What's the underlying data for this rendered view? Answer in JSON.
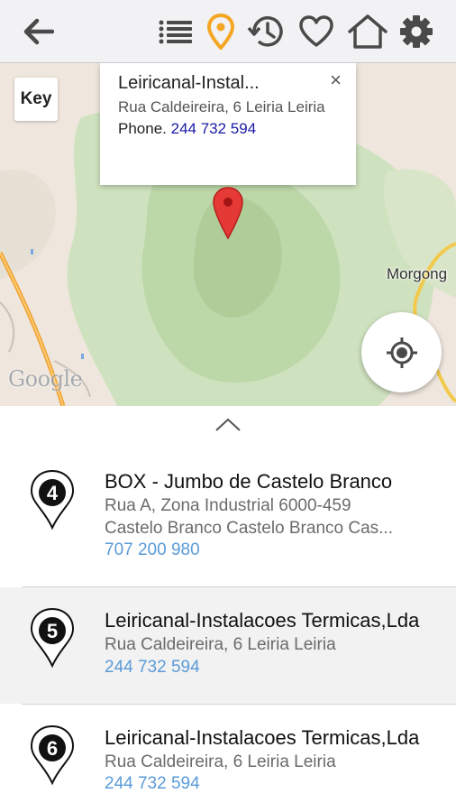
{
  "toolbar": {
    "icons": [
      "back-arrow-icon",
      "list-icon",
      "map-pin-icon",
      "history-icon",
      "heart-icon",
      "home-icon",
      "gear-icon"
    ],
    "accent": "#f5a623",
    "icon_color": "#4a4a4a"
  },
  "map": {
    "key_label": "Key",
    "place_label": "Morgong",
    "attribution": "Google",
    "marker_color": "#e53935",
    "info_window": {
      "title": "Leiricanal-Instal...",
      "address": "Rua Caldeireira, 6 Leiria Leiria",
      "phone_prefix": "Phone.",
      "phone": "244 732 594"
    }
  },
  "list": {
    "items": [
      {
        "number": "4",
        "title": "BOX - Jumbo de Castelo Branco",
        "address_line1": "Rua A, Zona Industrial 6000-459",
        "address_line2": "Castelo Branco Castelo Branco Cas...",
        "phone": "707 200 980",
        "selected": false
      },
      {
        "number": "5",
        "title": "Leiricanal-Instalacoes Termicas,Lda",
        "address_line1": "Rua Caldeireira, 6 Leiria Leiria",
        "phone": "244 732 594",
        "selected": true
      },
      {
        "number": "6",
        "title": "Leiricanal-Instalacoes Termicas,Lda",
        "address_line1": "Rua Caldeireira, 6 Leiria Leiria",
        "phone": "244 732 594",
        "selected": false
      }
    ]
  }
}
